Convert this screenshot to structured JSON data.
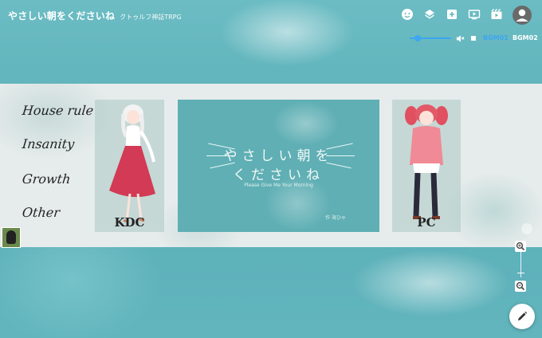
{
  "header": {
    "title": "やさしい朝をくださいね",
    "subtitle": "クトゥルフ神話TRPG"
  },
  "toolbar": {
    "icons": [
      "face-icon",
      "layers-icon",
      "add-box-icon",
      "video-icon",
      "movie-icon",
      "account-icon"
    ]
  },
  "bgm": {
    "volume_percent": 20,
    "tabs": [
      "BGM01",
      "BGM02"
    ],
    "active_tab": "BGM01",
    "accent_color": "#3da6f0"
  },
  "stage": {
    "menu": [
      "House rule",
      "Insanity",
      "Growth",
      "Other"
    ],
    "left_character_label": "KDC",
    "right_character_label": "PC",
    "banner_title_line1": "やさしい朝を",
    "banner_title_line2": "くださいね",
    "banner_subtitle": "Please Give Me Your Morning",
    "banner_credit": "作 海ひゃ"
  },
  "colors": {
    "background": "#5fb3bb",
    "strip": "#e6eceb"
  }
}
